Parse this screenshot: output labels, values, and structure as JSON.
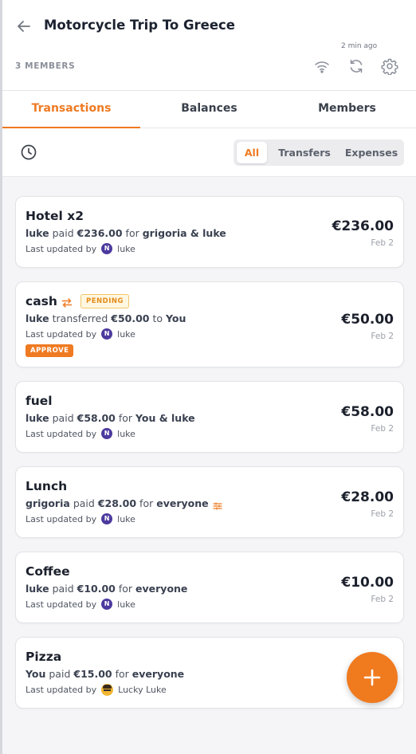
{
  "header": {
    "title": "Motorcycle Trip To Greece",
    "members_count": "3 MEMBERS",
    "sync_time": "2 min ago"
  },
  "tabs": [
    {
      "label": "Transactions",
      "active": true
    },
    {
      "label": "Balances",
      "active": false
    },
    {
      "label": "Members",
      "active": false
    }
  ],
  "filter": {
    "options": [
      "All",
      "Transfers",
      "Expenses"
    ],
    "selected": "All"
  },
  "transactions": [
    {
      "title": "Hotel x2",
      "payer": "luke",
      "verb": "paid",
      "amount_inline": "€236.00",
      "prep": "for",
      "target": "grigoria & luke",
      "updated_label": "Last updated by",
      "updated_by": "luke",
      "avatar_letter": "N",
      "amount": "€236.00",
      "date": "Feb 2"
    },
    {
      "title": "cash",
      "badge": "PENDING",
      "payer": "luke",
      "verb": "transferred",
      "amount_inline": "€50.00",
      "prep": "to",
      "target": "You",
      "updated_label": "Last updated by",
      "updated_by": "luke",
      "avatar_letter": "N",
      "action": "APPROVE",
      "amount": "€50.00",
      "date": "Feb 2"
    },
    {
      "title": "fuel",
      "payer": "luke",
      "verb": "paid",
      "amount_inline": "€58.00",
      "prep": "for",
      "target": "You & luke",
      "updated_label": "Last updated by",
      "updated_by": "luke",
      "avatar_letter": "N",
      "amount": "€58.00",
      "date": "Feb 2"
    },
    {
      "title": "Lunch",
      "payer": "grigoria",
      "verb": "paid",
      "amount_inline": "€28.00",
      "prep": "for",
      "target": "everyone",
      "updated_label": "Last updated by",
      "updated_by": "luke",
      "avatar_letter": "N",
      "amount": "€28.00",
      "date": "Feb 2"
    },
    {
      "title": "Coffee",
      "payer": "luke",
      "verb": "paid",
      "amount_inline": "€10.00",
      "prep": "for",
      "target": "everyone",
      "updated_label": "Last updated by",
      "updated_by": "luke",
      "avatar_letter": "N",
      "amount": "€10.00",
      "date": "Feb 2"
    },
    {
      "title": "Pizza",
      "payer": "You",
      "verb": "paid",
      "amount_inline": "€15.00",
      "prep": "for",
      "target": "everyone",
      "updated_label": "Last updated by",
      "updated_by": "Lucky Luke"
    }
  ],
  "icons": {
    "back": "arrow-left-icon",
    "wifi": "wifi-icon",
    "sync": "refresh-icon",
    "settings": "gear-icon",
    "history": "clock-icon",
    "transfer": "transfer-icon",
    "custom_split": "sliders-icon",
    "add": "plus-icon"
  },
  "colors": {
    "accent": "#ef7a22",
    "avatar": "#4c3a9e",
    "pending_badge": "#e38b18"
  }
}
